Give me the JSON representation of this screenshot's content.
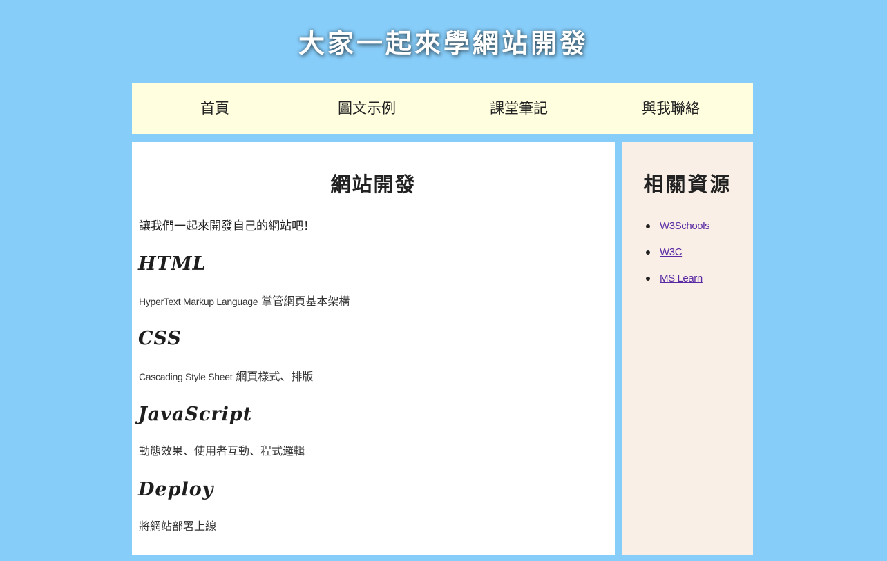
{
  "header": {
    "title": "大家一起來學網站開發"
  },
  "nav": {
    "items": [
      {
        "label": "首頁"
      },
      {
        "label": "圖文示例"
      },
      {
        "label": "課堂筆記"
      },
      {
        "label": "與我聯絡"
      }
    ]
  },
  "main": {
    "title": "網站開發",
    "intro": "讓我們一起來開發自己的網站吧！",
    "topics": [
      {
        "heading": "HTML",
        "desc_latin": "HyperText Markup Language",
        "desc": " 掌管網頁基本架構"
      },
      {
        "heading": "CSS",
        "desc_latin": "Cascading Style Sheet",
        "desc": " 網頁樣式、排版"
      },
      {
        "heading": "JavaScript",
        "desc_latin": "",
        "desc": "動態效果、使用者互動、程式邏輯"
      },
      {
        "heading": "Deploy",
        "desc_latin": "",
        "desc": "將網站部署上線"
      }
    ]
  },
  "aside": {
    "title": "相關資源",
    "links": [
      {
        "label": "W3Schools"
      },
      {
        "label": "W3C"
      },
      {
        "label": "MS Learn"
      }
    ]
  },
  "colors": {
    "page_background": "#87cdf9",
    "nav_background": "#fffedf",
    "main_background": "#ffffff",
    "aside_background": "#f9efe6",
    "link_color": "#5a2aa3"
  }
}
